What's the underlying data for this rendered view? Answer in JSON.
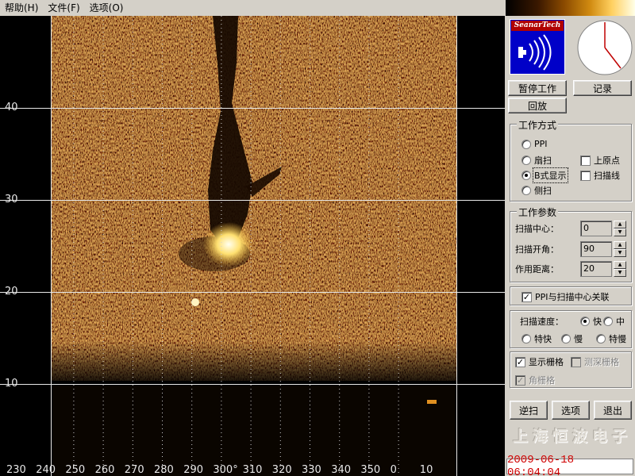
{
  "menu": {
    "items": [
      "帮助(H)",
      "文件(F)",
      "选项(O)"
    ]
  },
  "logo": {
    "name": "SeanarTech"
  },
  "buttons": {
    "pause": "暂停工作",
    "record": "记录",
    "playback": "回放",
    "reverse": "逆扫",
    "options": "选项",
    "exit": "退出"
  },
  "mode": {
    "title": "工作方式",
    "ppi": "PPI",
    "sector": "扇扫",
    "bscan": "B式显示",
    "side": "侧扫",
    "upper_origin": "上原点",
    "scan_line": "扫描线",
    "selected": "B式显示"
  },
  "params": {
    "title": "工作参数",
    "center_label": "扫描中心：",
    "center_value": "0",
    "angle_label": "扫描开角：",
    "angle_value": "90",
    "range_label": "作用距离：",
    "range_value": "20"
  },
  "link": {
    "label": "PPI与扫描中心关联",
    "checked": true
  },
  "speed": {
    "label": "扫描速度：",
    "fast": "快",
    "medium": "中",
    "extra_fast": "特快",
    "slow": "慢",
    "extra_slow": "特慢",
    "selected": "快"
  },
  "grids": {
    "show_grid": "显示栅格",
    "depth_grid": "测深栅格",
    "angle_grid": "角栅格",
    "show_grid_checked": true
  },
  "watermark": "上海恒波电子",
  "datetime": "2009-06-18 06:04:04",
  "depth_labels": [
    "40",
    "30",
    "20",
    "10"
  ],
  "bearing_labels": [
    "230",
    "240",
    "250",
    "260",
    "270",
    "280",
    "290",
    "300°",
    "310",
    "320",
    "330",
    "340",
    "350",
    "0",
    "10"
  ],
  "colors": {
    "panel_bg": "#d4d0c8",
    "logo_blue": "#0000c8",
    "logo_red": "#b00000",
    "datetime_red": "#d00000",
    "sonar_amber": "#c87818"
  }
}
